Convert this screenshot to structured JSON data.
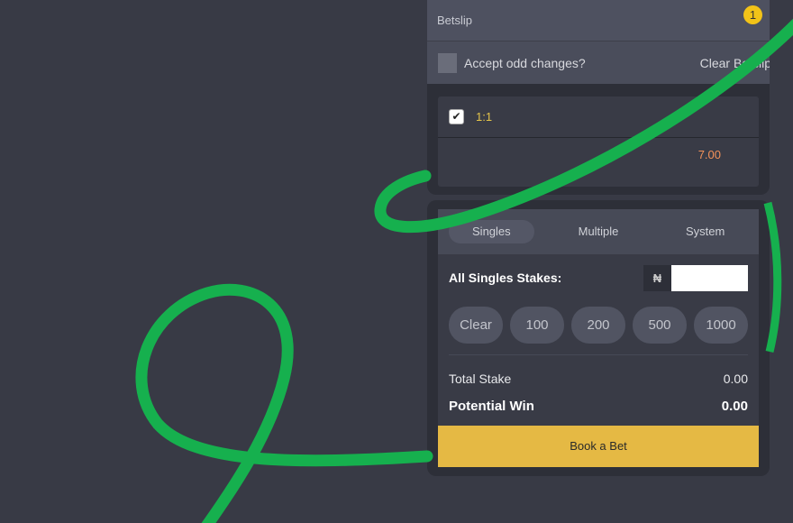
{
  "betslip": {
    "title": "Betslip",
    "count": "1",
    "accept_label": "Accept odd changes?",
    "clear_label": "Clear Betslip",
    "selection": {
      "name": "1:1",
      "odds": "7.00",
      "checked": true
    }
  },
  "tabs": [
    {
      "label": "Singles",
      "active": true
    },
    {
      "label": "Multiple"
    },
    {
      "label": "System"
    }
  ],
  "stakes": {
    "label": "All Singles Stakes:",
    "currency": "₦",
    "value": ""
  },
  "quick": [
    "Clear",
    "100",
    "200",
    "500",
    "1000"
  ],
  "totals": {
    "stake_label": "Total Stake",
    "stake": "0.00",
    "win_label": "Potential Win",
    "win": "0.00"
  },
  "book_label": "Book a Bet",
  "colors": {
    "accent": "#e5b944",
    "badge": "#f2c318",
    "curve": "#16b04e",
    "odds": "#f3925a"
  }
}
